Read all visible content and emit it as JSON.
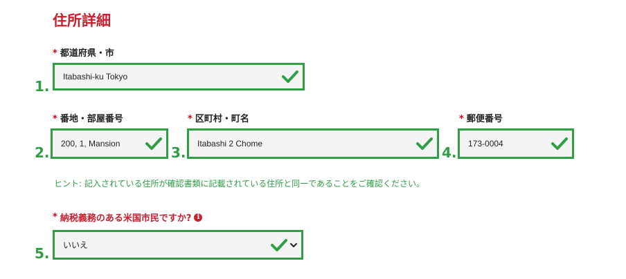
{
  "section_title": "住所詳細",
  "required_mark": "*",
  "fields": {
    "city": {
      "step": "1.",
      "label": "都道府県・市",
      "value": "Itabashi-ku Tokyo"
    },
    "street": {
      "step": "2.",
      "label": "番地・部屋番号",
      "value": "200, 1, Mansion"
    },
    "district": {
      "step": "3.",
      "label": "区町村・町名",
      "value": "Itabashi 2 Chome"
    },
    "postal": {
      "step": "4.",
      "label": "郵便番号",
      "value": "173-0004"
    }
  },
  "hint": "ヒント: 記入されている住所が確認書類に記載されている住所と同一であることをご確認ください。",
  "tax_question": {
    "step": "5.",
    "label": "納税義務のある米国市民ですか?",
    "info_icon": "i",
    "selected": "いいえ"
  },
  "colors": {
    "accent_red": "#c8202f",
    "highlight_green": "#2f9e44"
  },
  "icons": [
    "check-icon",
    "info-icon",
    "chevron-down-icon"
  ]
}
